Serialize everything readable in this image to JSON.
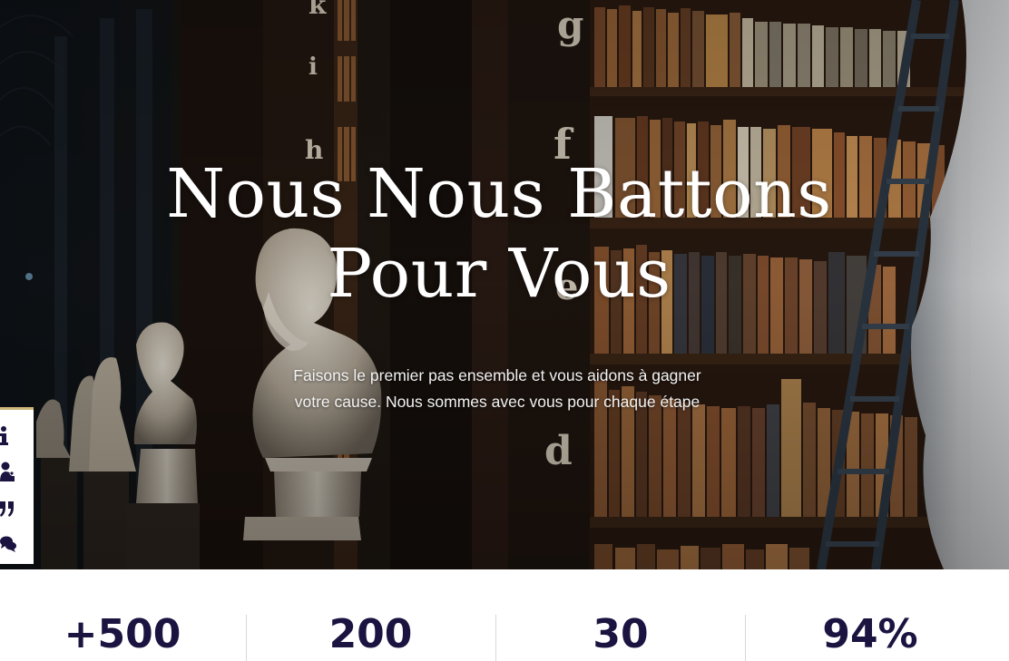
{
  "hero": {
    "title_line1": "Nous Nous Battons",
    "title_line2": "Pour Vous",
    "subtitle_line1": "Faisons le premier pas ensemble et vous aidons à gagner",
    "subtitle_line2": "votre cause. Nous sommes avec vous pour chaque étape",
    "shelf_letters": [
      "k",
      "i",
      "h",
      "g",
      "f",
      "e",
      "d"
    ]
  },
  "side_toolbar": {
    "items": [
      {
        "icon": "info-icon"
      },
      {
        "icon": "team-icon"
      },
      {
        "icon": "quote-icon"
      },
      {
        "icon": "comments-icon"
      }
    ],
    "accent_color": "#cfb679"
  },
  "stats": {
    "items": [
      {
        "value": "+500"
      },
      {
        "value": "200"
      },
      {
        "value": "30"
      },
      {
        "value": "94%"
      }
    ],
    "value_color": "#1b1340"
  }
}
